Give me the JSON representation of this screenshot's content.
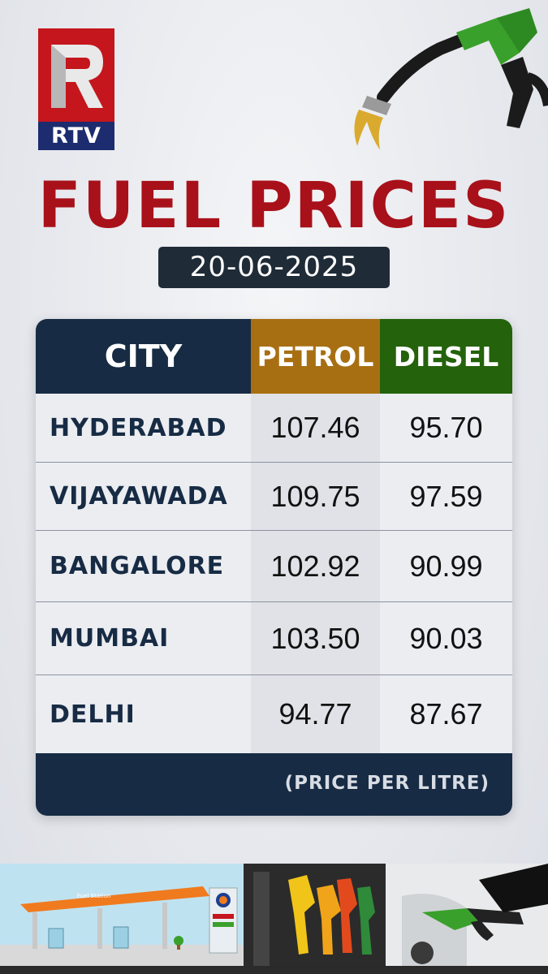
{
  "brand": {
    "logo_text": "RTV",
    "red": "#c4161c",
    "blue": "#1c2c6e"
  },
  "title": "FUEL PRICES",
  "date": "20-06-2025",
  "table": {
    "headers": {
      "city": "CITY",
      "petrol": "PETROL",
      "diesel": "DIESEL"
    },
    "rows": [
      {
        "city": "HYDERABAD",
        "petrol": "107.46",
        "diesel": "95.70"
      },
      {
        "city": "VIJAYAWADA",
        "petrol": "109.75",
        "diesel": "97.59"
      },
      {
        "city": "BANGALORE",
        "petrol": "102.92",
        "diesel": "90.99"
      },
      {
        "city": "MUMBAI",
        "petrol": "103.50",
        "diesel": "90.03"
      },
      {
        "city": "DELHI",
        "petrol": "94.77",
        "diesel": "87.67"
      }
    ],
    "footer_note": "(PRICE PER LITRE)"
  },
  "illustrations": {
    "top_right": "fuel-nozzle-icon",
    "bottom_left": "fuel-station-icon",
    "bottom_middle": "fuel-pumps-icon",
    "bottom_right": "car-refuel-icon",
    "station_sign": "Fuel Station"
  },
  "colors": {
    "title": "#a8111a",
    "header_city": "#172b44",
    "header_petrol": "#a86f12",
    "header_diesel": "#24620c"
  }
}
